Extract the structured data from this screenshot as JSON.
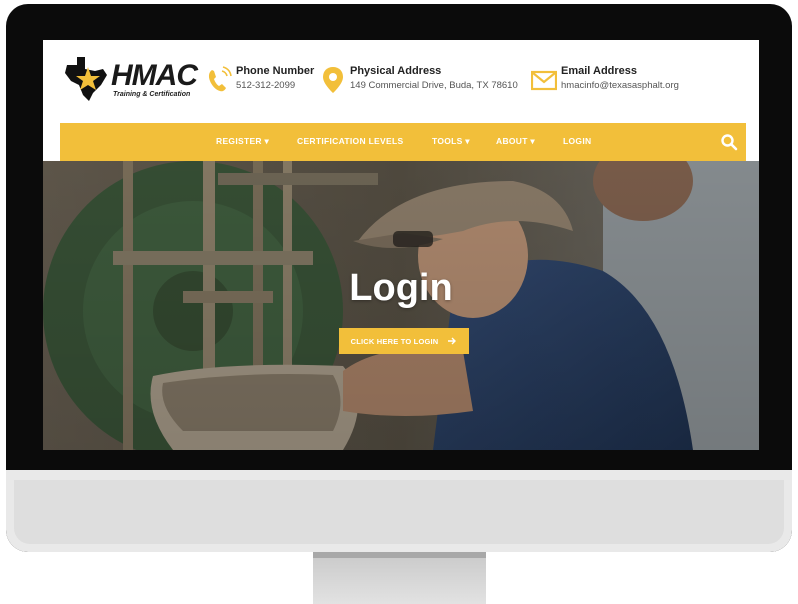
{
  "brand": {
    "name": "HMAC",
    "tagline": "Training & Certification",
    "accent_color": "#f2bf3a"
  },
  "contact": {
    "phone": {
      "title": "Phone Number",
      "value": "512-312-2099",
      "icon": "phone-icon"
    },
    "address": {
      "title": "Physical Address",
      "value": "149 Commercial Drive, Buda, TX 78610",
      "icon": "map-pin-icon"
    },
    "email": {
      "title": "Email Address",
      "value": "hmacinfo@texasasphalt.org",
      "icon": "envelope-icon"
    }
  },
  "nav": {
    "items": [
      {
        "label": "REGISTER ▾"
      },
      {
        "label": "CERTIFICATION LEVELS"
      },
      {
        "label": "TOOLS ▾"
      },
      {
        "label": "ABOUT ▾"
      },
      {
        "label": "LOGIN"
      }
    ],
    "search_icon": "search-icon"
  },
  "hero": {
    "title": "Login",
    "button_label": "CLICK HERE TO LOGIN",
    "button_icon": "arrow-right-icon"
  }
}
